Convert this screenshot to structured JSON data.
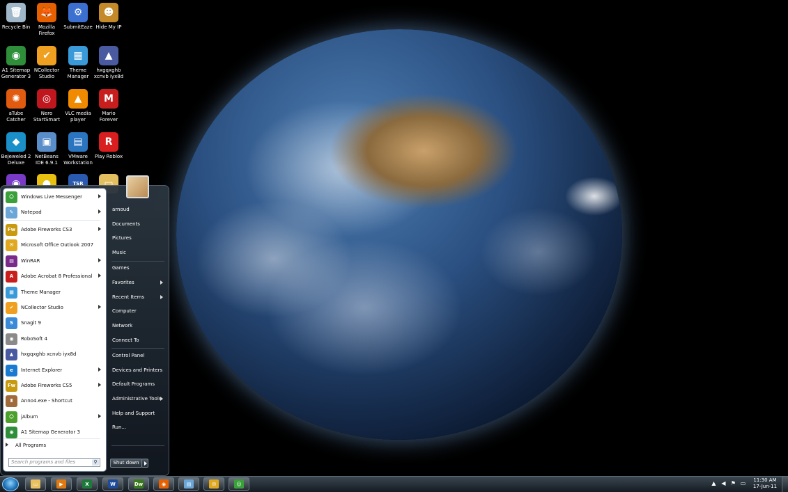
{
  "desktop": {
    "icons": [
      {
        "label": "Recycle Bin",
        "icon": "recycle-bin-icon",
        "color": "#9fb7c9",
        "glyph": "🗑"
      },
      {
        "label": "Mozilla Firefox",
        "icon": "firefox-icon",
        "color": "#e66000",
        "glyph": "🦊"
      },
      {
        "label": "SubmitEaze",
        "icon": "gear-icon",
        "color": "#3b6fd0",
        "glyph": "⚙"
      },
      {
        "label": "Hide My IP",
        "icon": "hide-my-ip-icon",
        "color": "#c48a2a",
        "glyph": "☻"
      },
      {
        "label": "A1 Sitemap Generator 3",
        "icon": "sitemap-icon",
        "color": "#2f8e3a",
        "glyph": "◉"
      },
      {
        "label": "NCollector Studio",
        "icon": "ncollector-icon",
        "color": "#f0a020",
        "glyph": "✔"
      },
      {
        "label": "Theme Manager",
        "icon": "theme-manager-icon",
        "color": "#3a9ad9",
        "glyph": "▦"
      },
      {
        "label": "hxgqxghb xcnvb iyx8d",
        "icon": "shortcut-icon",
        "color": "#4a5aa0",
        "glyph": "▲"
      },
      {
        "label": "aTube Catcher",
        "icon": "atube-icon",
        "color": "#e05a10",
        "glyph": "✺"
      },
      {
        "label": "Nero StartSmart",
        "icon": "nero-icon",
        "color": "#c0161e",
        "glyph": "◎"
      },
      {
        "label": "VLC media player",
        "icon": "vlc-icon",
        "color": "#f08a00",
        "glyph": "▲"
      },
      {
        "label": "Mario Forever",
        "icon": "mario-icon",
        "color": "#c81e1e",
        "glyph": "M"
      },
      {
        "label": "Bejeweled 2 Deluxe",
        "icon": "bejeweled-icon",
        "color": "#1a8fc8",
        "glyph": "◆"
      },
      {
        "label": "NetBeans IDE 6.9.1",
        "icon": "netbeans-icon",
        "color": "#5a8ec8",
        "glyph": "▣"
      },
      {
        "label": "VMware Workstation",
        "icon": "vmware-icon",
        "color": "#2a74c0",
        "glyph": "▤"
      },
      {
        "label": "Play Roblox",
        "icon": "roblox-icon",
        "color": "#d81e1e",
        "glyph": "R"
      }
    ],
    "partial_icons": [
      {
        "icon": "media-icon",
        "color": "#7a3ac8",
        "glyph": "◉"
      },
      {
        "icon": "cd-icon",
        "color": "#e8c010",
        "glyph": "●"
      },
      {
        "icon": "tsr-watermark-icon",
        "color": "#2a5ab0",
        "glyph": "TSR"
      },
      {
        "icon": "folder-icon",
        "color": "#e2c060",
        "glyph": "▭"
      }
    ]
  },
  "start_menu": {
    "programs": [
      {
        "label": "Windows Live Messenger",
        "icon": "messenger-icon",
        "color": "#3aa03a",
        "glyph": "☺",
        "submenu": true
      },
      {
        "label": "Notepad",
        "icon": "notepad-icon",
        "color": "#6aa6d8",
        "glyph": "✎",
        "submenu": true
      },
      {
        "label": "Adobe Fireworks CS3",
        "icon": "fireworks-icon",
        "color": "#c89a10",
        "glyph": "Fw",
        "submenu": true
      },
      {
        "label": "Microsoft Office Outlook 2007",
        "icon": "outlook-icon",
        "color": "#e0a820",
        "glyph": "✉",
        "submenu": false
      },
      {
        "label": "WinRAR",
        "icon": "winrar-icon",
        "color": "#7a2a8a",
        "glyph": "▤",
        "submenu": true
      },
      {
        "label": "Adobe Acrobat 8 Professional",
        "icon": "acrobat-icon",
        "color": "#c81e1e",
        "glyph": "A",
        "submenu": true
      },
      {
        "label": "Theme Manager",
        "icon": "theme-manager-icon",
        "color": "#3a9ad9",
        "glyph": "▦",
        "submenu": false
      },
      {
        "label": "NCollector Studio",
        "icon": "ncollector-icon",
        "color": "#f0a020",
        "glyph": "✔",
        "submenu": true
      },
      {
        "label": "Snagit 9",
        "icon": "snagit-icon",
        "color": "#3a8ad8",
        "glyph": "S",
        "submenu": false
      },
      {
        "label": "RoboSoft 4",
        "icon": "robosoft-icon",
        "color": "#8a8a8a",
        "glyph": "◉",
        "submenu": false
      },
      {
        "label": "hxgqxghb xcnvb iyx8d",
        "icon": "shortcut-icon",
        "color": "#4a5aa0",
        "glyph": "▲",
        "submenu": false
      },
      {
        "label": "Internet Explorer",
        "icon": "internet-explorer-icon",
        "color": "#1a7ad0",
        "glyph": "e",
        "submenu": true
      },
      {
        "label": "Adobe Fireworks CS5",
        "icon": "fireworks-icon",
        "color": "#c89a10",
        "glyph": "Fw",
        "submenu": true
      },
      {
        "label": "Anno4.exe - Shortcut",
        "icon": "anno-icon",
        "color": "#a06a3a",
        "glyph": "♜",
        "submenu": false
      },
      {
        "label": "jAlbum",
        "icon": "jalbum-icon",
        "color": "#4aa02a",
        "glyph": "☺",
        "submenu": true
      },
      {
        "label": "A1 Sitemap Generator 3",
        "icon": "sitemap-icon",
        "color": "#2f8e3a",
        "glyph": "◉",
        "submenu": false
      }
    ],
    "all_programs": "All Programs",
    "search_placeholder": "Search programs and files",
    "right": [
      {
        "label": "arnoud",
        "submenu": false
      },
      {
        "label": "Documents",
        "submenu": false
      },
      {
        "label": "Pictures",
        "submenu": false
      },
      {
        "label": "Music",
        "submenu": false
      },
      {
        "label": "Games",
        "submenu": false
      },
      {
        "label": "Favorites",
        "submenu": true
      },
      {
        "label": "Recent Items",
        "submenu": true
      },
      {
        "label": "Computer",
        "submenu": false
      },
      {
        "label": "Network",
        "submenu": false
      },
      {
        "label": "Connect To",
        "submenu": false
      },
      {
        "label": "Control Panel",
        "submenu": false
      },
      {
        "label": "Devices and Printers",
        "submenu": false
      },
      {
        "label": "Default Programs",
        "submenu": false
      },
      {
        "label": "Administrative Tools",
        "submenu": true
      },
      {
        "label": "Help and Support",
        "submenu": false
      },
      {
        "label": "Run...",
        "submenu": false
      }
    ],
    "shutdown_label": "Shut down"
  },
  "taskbar": {
    "buttons": [
      {
        "icon": "windows-explorer-icon",
        "color": "#e8c060",
        "glyph": "▭"
      },
      {
        "icon": "media-player-icon",
        "color": "#e07a10",
        "glyph": "▶"
      },
      {
        "icon": "excel-icon",
        "color": "#1e7a3a",
        "glyph": "X"
      },
      {
        "icon": "word-icon",
        "color": "#1e4a9a",
        "glyph": "W"
      },
      {
        "icon": "dreamweaver-icon",
        "color": "#3a7a1e",
        "glyph": "Dw"
      },
      {
        "icon": "firefox-icon",
        "color": "#e66000",
        "glyph": "◉"
      },
      {
        "icon": "notepad-icon",
        "color": "#6aa6d8",
        "glyph": "▤"
      },
      {
        "icon": "outlook-icon",
        "color": "#e0a820",
        "glyph": "✉"
      },
      {
        "icon": "messenger-icon",
        "color": "#3aa03a",
        "glyph": "☺"
      }
    ],
    "tray": [
      {
        "icon": "show-hidden-icons-icon",
        "glyph": "▲"
      },
      {
        "icon": "volume-icon",
        "glyph": "◀"
      },
      {
        "icon": "action-center-flag-icon",
        "glyph": "⚑"
      },
      {
        "icon": "network-icon",
        "glyph": "▭"
      }
    ],
    "time": "11:30 AM",
    "date": "17-Jun-11"
  }
}
